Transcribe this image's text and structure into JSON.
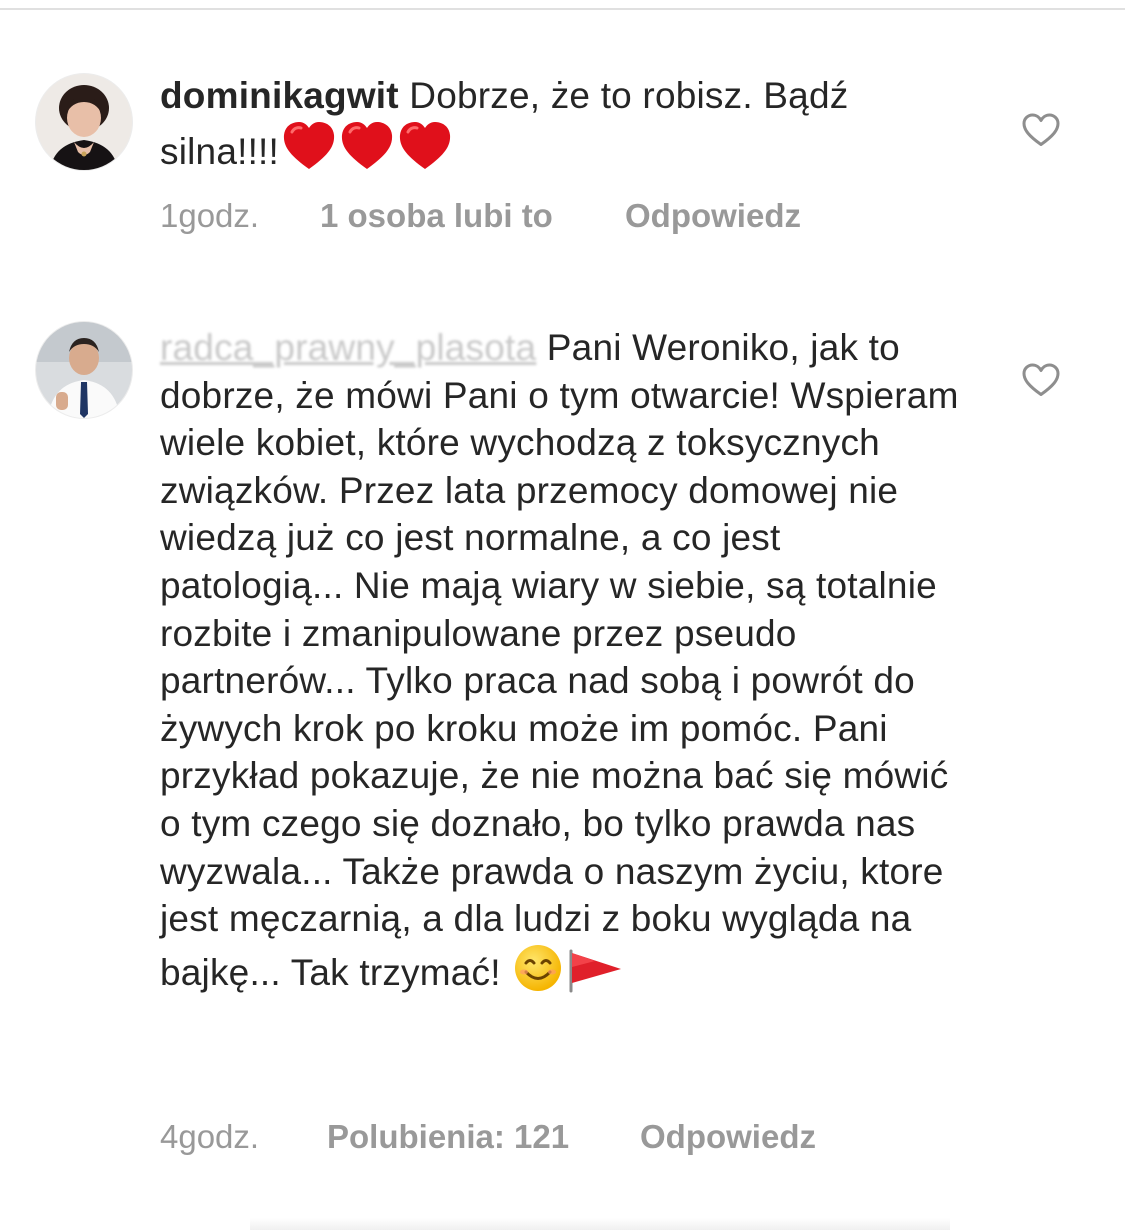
{
  "comments": [
    {
      "username": "dominikagwit",
      "text": "Dobrze, że to robisz. Bądź silna!!!!",
      "emoji": [
        "red-heart",
        "red-heart",
        "red-heart"
      ],
      "time": "1godz.",
      "likes": "1 osoba lubi to",
      "reply": "Odpowiedz",
      "avatar": "profile-photo"
    },
    {
      "username": "radca_prawny_plasota",
      "username_blurred": true,
      "text": "Pani Weroniko, jak to dobrze, że mówi Pani o tym otwarcie! Wspieram wiele kobiet, które wychodzą z toksycznych związków. Przez lata przemocy domowej nie wiedzą już co jest normalne, a co jest patologią... Nie mają wiary w siebie, są totalnie rozbite i zmanipulowane przez pseudo partnerów... Tylko praca nad sobą i powrót do żywych krok po kroku może im pomóc. Pani przykład pokazuje, że nie można bać się mówić o tym czego się doznało, bo tylko prawda nas wyzwala... Także prawda o naszym życiu, ktore jest męczarnią, a dla ludzi z boku wygląda na bajkę... Tak trzymać!",
      "emoji": [
        "smiling-face",
        "red-flag"
      ],
      "time": "4godz.",
      "likes": "Polubienia: 121",
      "reply": "Odpowiedz",
      "avatar": "profile-photo"
    }
  ],
  "icons": {
    "like": "heart-outline-icon"
  },
  "colors": {
    "text": "#262626",
    "meta": "#999999",
    "heart": "#e0101b",
    "divider": "#e0e0e0"
  }
}
